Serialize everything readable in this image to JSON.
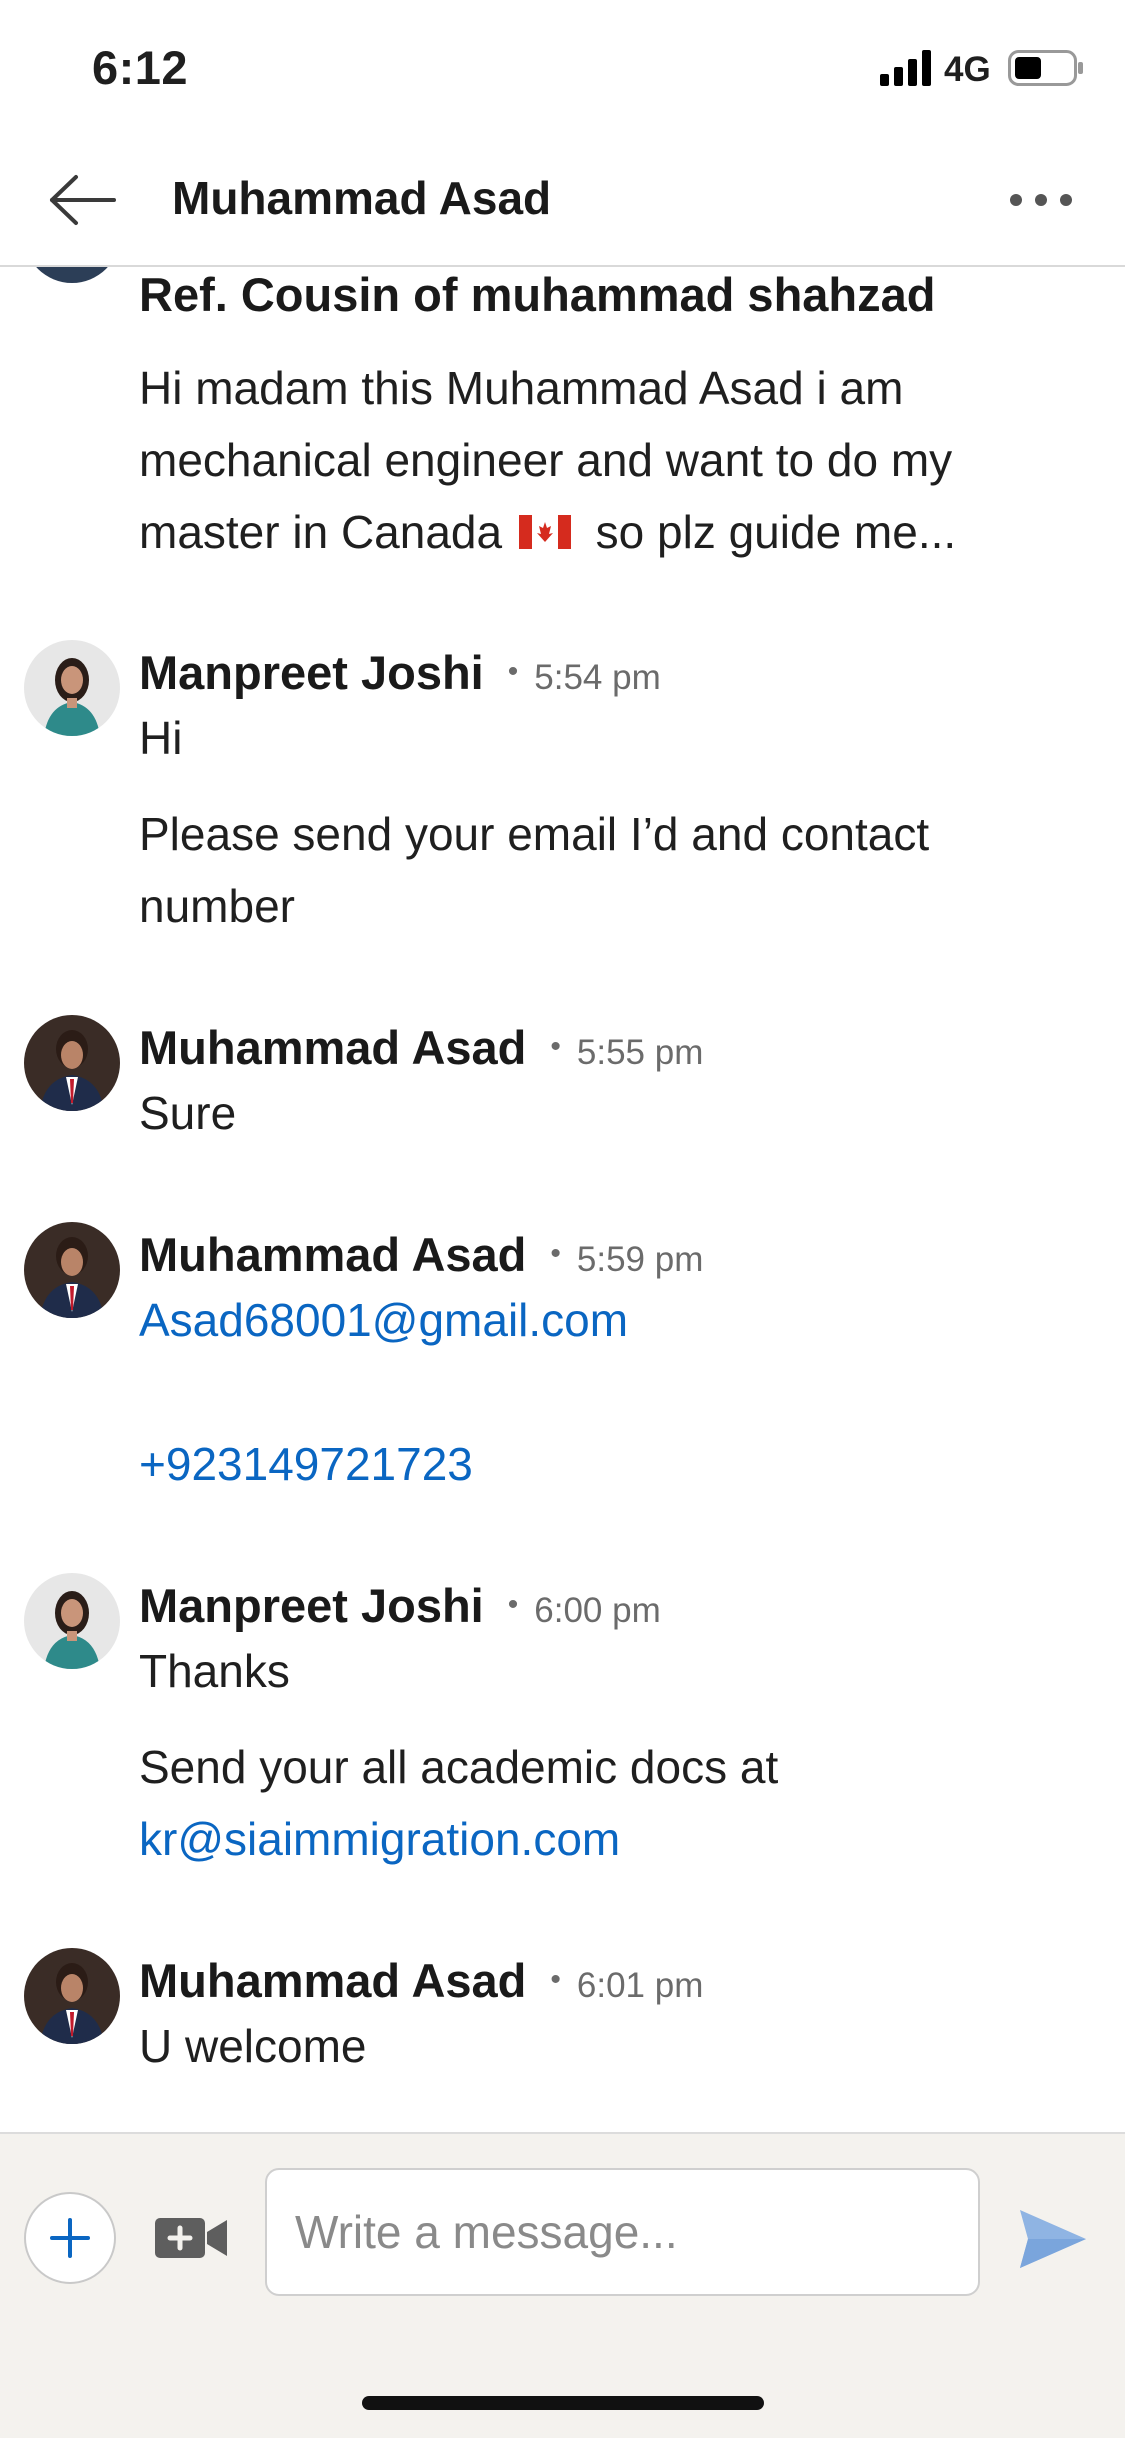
{
  "status_bar": {
    "time": "6:12",
    "network": "4G",
    "signal_icon": "cellular-signal-icon",
    "battery_icon": "battery-icon"
  },
  "header": {
    "title": "Muhammad Asad",
    "back_icon": "arrow-left-icon",
    "more_icon": "more-horizontal-icon"
  },
  "conversation": {
    "partial_message": {
      "ref_line": "Ref. Cousin of muhammad shahzad",
      "text_before_flag": "Hi madam this Muhammad Asad i am mechanical engineer and want to do my master in Canada",
      "flag_icon": "canada-flag-icon",
      "text_after_flag": "so plz guide me..."
    },
    "messages": [
      {
        "sender": "Manpreet Joshi",
        "time": "5:54 pm",
        "lines": [
          "Hi",
          "Please send your email I’d and contact number"
        ]
      },
      {
        "sender": "Muhammad Asad",
        "time": "5:55 pm",
        "lines": [
          "Sure"
        ]
      },
      {
        "sender": "Muhammad Asad",
        "time": "5:59 pm",
        "email_link": "Asad68001@gmail.com",
        "phone_link": "+923149721723"
      },
      {
        "sender": "Manpreet Joshi",
        "time": "6:00 pm",
        "lines": [
          "Thanks",
          "Send your all academic docs at"
        ],
        "email_link": "kr@siaimmigration.com"
      },
      {
        "sender": "Muhammad Asad",
        "time": "6:01 pm",
        "lines": [
          "U welcome"
        ]
      }
    ],
    "meta_separator": "•"
  },
  "composer": {
    "placeholder": "Write a message...",
    "value": "",
    "add_icon": "plus-icon",
    "video_icon": "video-camera-icon",
    "send_icon": "send-icon"
  },
  "colors": {
    "link": "#0a66c2",
    "send_icon": "#8fb4e3",
    "composer_bg": "#f4f2ee"
  }
}
